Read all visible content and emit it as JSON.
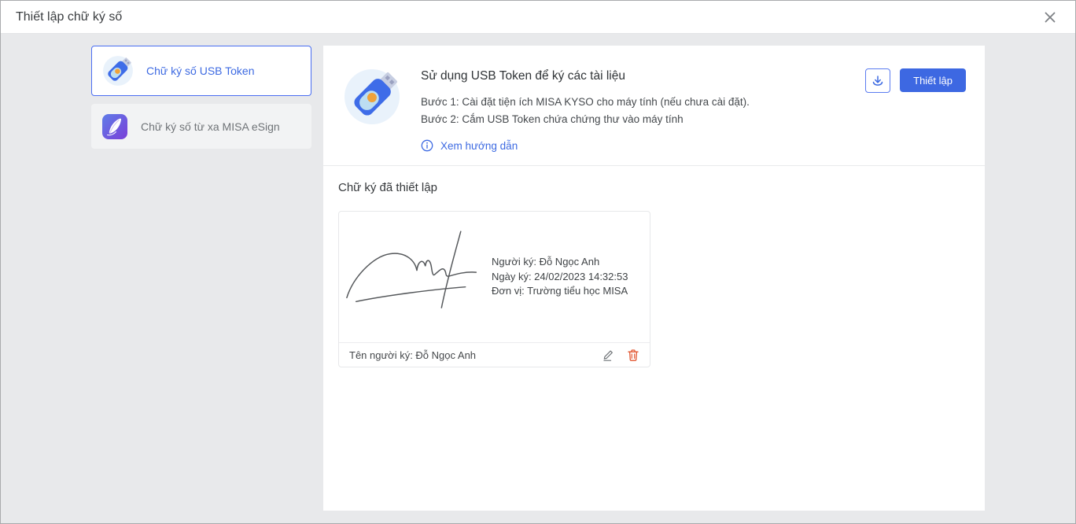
{
  "dialog": {
    "title": "Thiết lập chữ ký số"
  },
  "sidebar": {
    "items": [
      {
        "label": "Chữ ký số USB Token",
        "selected": true
      },
      {
        "label": "Chữ ký số từ xa MISA eSign",
        "selected": false
      }
    ]
  },
  "usb_section": {
    "title": "Sử dụng USB Token để ký các tài liệu",
    "steps": [
      "Bước 1: Cài đặt tiện ích MISA KYSO cho máy tính (nếu chưa cài đặt).",
      "Bước 2: Cắm USB Token chứa chứng thư vào máy tính"
    ],
    "guide_link": "Xem hướng dẫn",
    "setup_button": "Thiết lập"
  },
  "signatures": {
    "section_title": "Chữ ký đã thiết lập",
    "cards": [
      {
        "signer": "Người ký: Đỗ Ngọc Anh",
        "signed_date": "Ngày ký: 24/02/2023 14:32:53",
        "unit": "Đơn vị: Trường tiểu học MISA",
        "footer_name": "Tên người ký: Đỗ Ngọc Anh"
      }
    ]
  },
  "icons": {
    "close": "close-icon",
    "download": "download-icon",
    "info": "info-circle-icon",
    "edit": "edit-pencil-icon",
    "delete": "trash-icon",
    "usb_token": "usb-token-icon",
    "esign": "feather-icon"
  },
  "colors": {
    "accent": "#3d6ae2",
    "accent_border": "#4a6ef2",
    "danger": "#e2552f",
    "page_bg": "#e8e9eb"
  }
}
